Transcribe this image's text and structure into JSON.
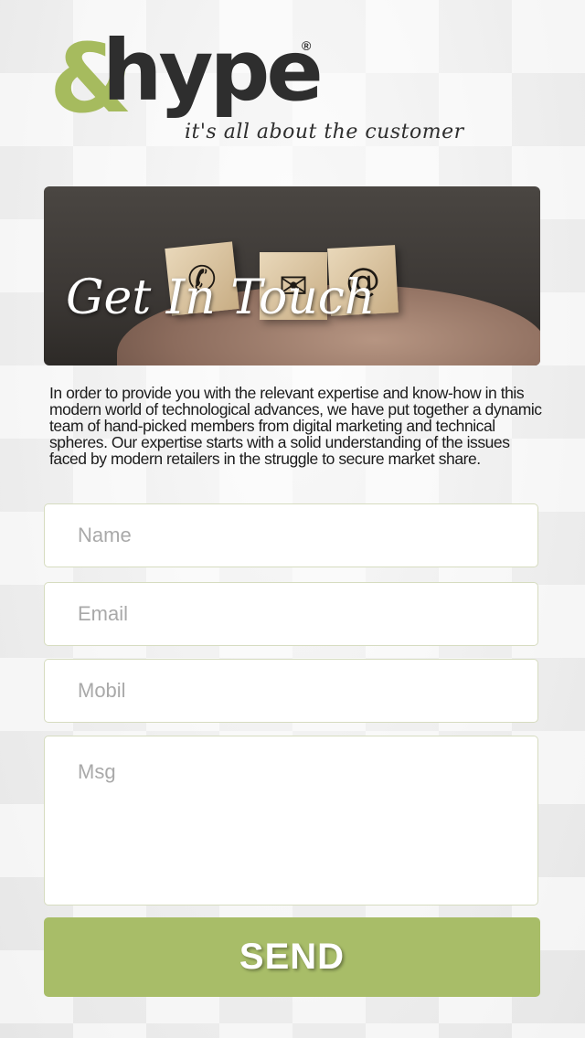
{
  "brand": {
    "amp": "&",
    "name": "hype",
    "registered": "®",
    "tagline": "it's all about the customer",
    "colors": {
      "green": "#a8bd68",
      "dark": "#2e2e2e"
    }
  },
  "hero": {
    "title": "Get In Touch",
    "cube_icons": [
      "phone-icon",
      "envelope-icon",
      "at-icon"
    ],
    "cube_glyphs": [
      "✆",
      "✉",
      "@"
    ]
  },
  "intro": {
    "text": "In order to provide you with the relevant expertise and know-how in this modern world of technological advances, we have put together a dynamic team of hand-picked members from digital marketing and technical spheres. Our expertise starts with a solid understanding of the issues faced by modern retailers in the struggle to secure market share."
  },
  "form": {
    "name_placeholder": "Name",
    "email_placeholder": "Email",
    "mobil_placeholder": "Mobil",
    "msg_placeholder": "Msg",
    "send_label": "SEND"
  }
}
